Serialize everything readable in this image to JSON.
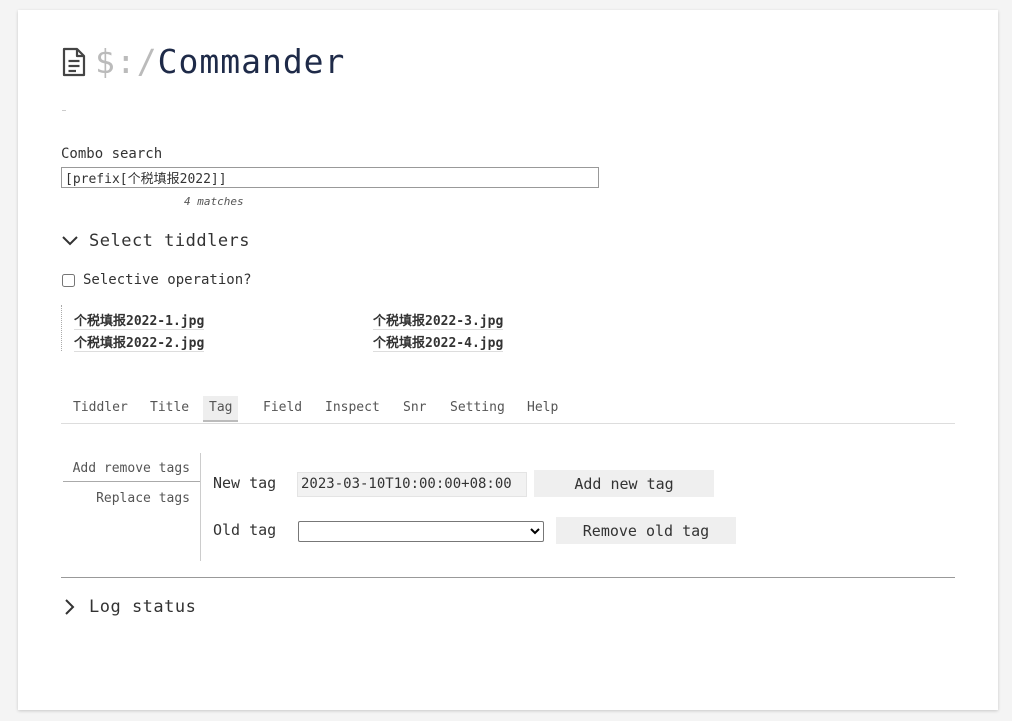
{
  "page": {
    "title_prefix": "$:/",
    "title_main": "Commander"
  },
  "combo": {
    "label": "Combo search",
    "value": "[prefix[个税填报2022]]",
    "matches": "4 matches"
  },
  "select_section": {
    "label": "Select tiddlers",
    "selective_label": "Selective operation?",
    "selective_checked": false
  },
  "tiddlers": [
    "个税填报2022-1.jpg",
    "个税填报2022-2.jpg",
    "个税填报2022-3.jpg",
    "个税填报2022-4.jpg"
  ],
  "tabs": [
    "Tiddler",
    "Title",
    "Tag",
    "Field",
    "Inspect",
    "Snr",
    "Setting",
    "Help"
  ],
  "active_tab": "Tag",
  "subtabs": [
    "Add remove tags",
    "Replace tags"
  ],
  "active_subtab": "Add remove tags",
  "tag_form": {
    "new_tag_label": "New tag",
    "new_tag_value": "2023-03-10T10:00:00+08:00",
    "add_button": "Add new tag",
    "old_tag_label": "Old tag",
    "old_tag_selected": "",
    "remove_button": "Remove old tag"
  },
  "log_section": {
    "label": "Log status"
  }
}
